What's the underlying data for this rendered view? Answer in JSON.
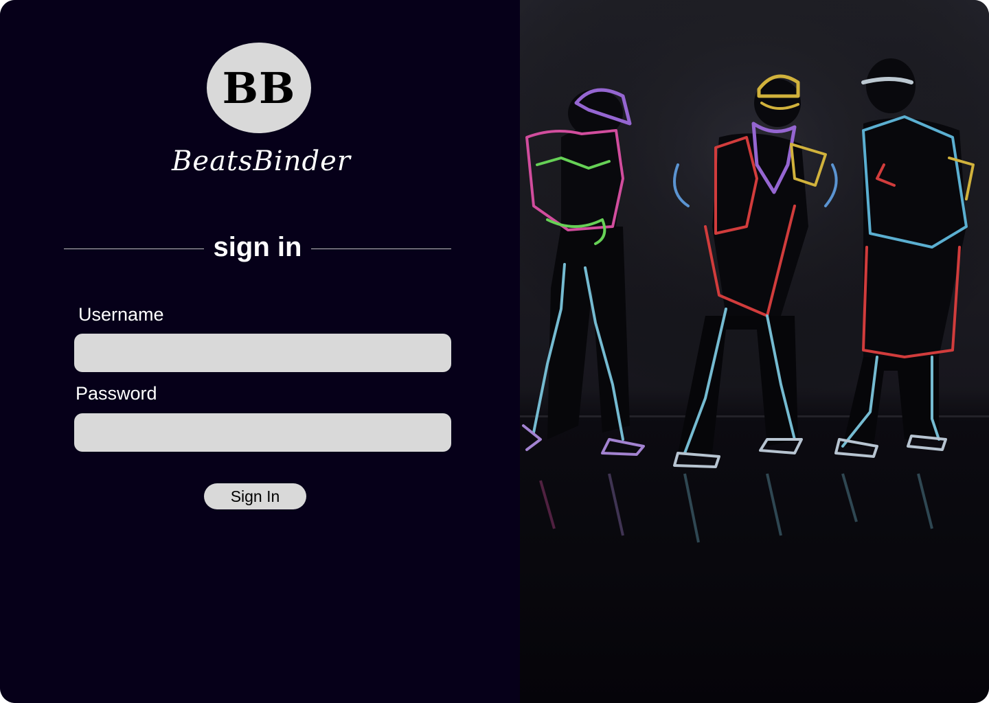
{
  "logo": {
    "initials": "BB",
    "name": "BeatsBinder"
  },
  "signin": {
    "title": "sign in",
    "username_label": "Username",
    "username_value": "",
    "password_label": "Password",
    "password_value": "",
    "button_label": "Sign In"
  },
  "hero": {
    "alt": "Three dancers in neon light-up suits"
  },
  "colors": {
    "background": "#060019",
    "field": "#d9d9d9",
    "text": "#ffffff"
  }
}
